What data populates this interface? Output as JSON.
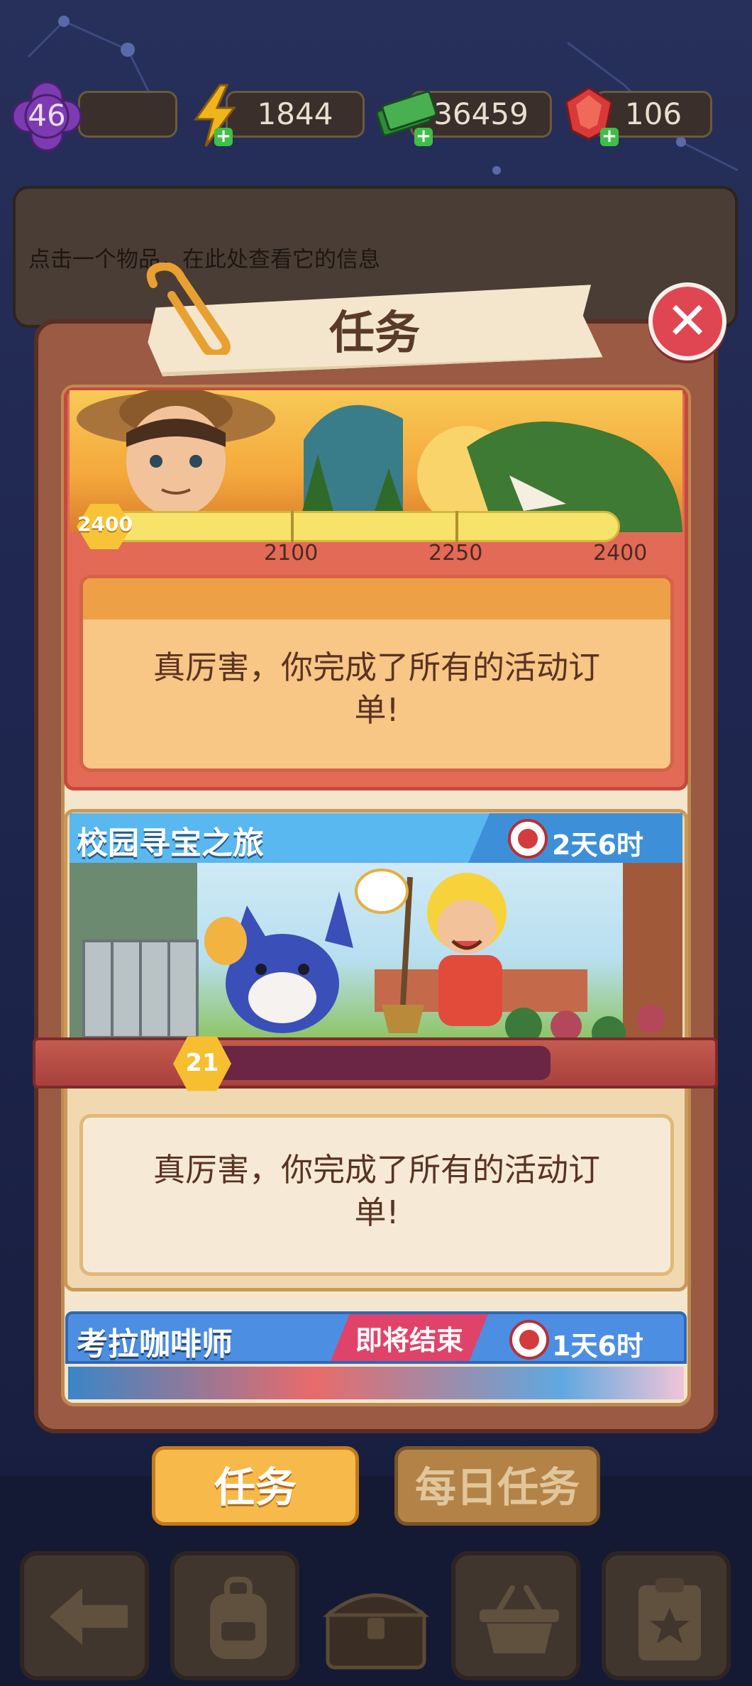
{
  "stats": {
    "level": "46",
    "energy": "1844",
    "cash": "36459",
    "gems": "106"
  },
  "info_panel": {
    "hint": "点击一个物品，在此处查看它的信息"
  },
  "dialog": {
    "title": "任务",
    "close_label": "✕"
  },
  "event_cards": [
    {
      "points": "2400",
      "milestones": [
        "2100",
        "2250",
        "2400"
      ],
      "message_line1": "真厉害，你完成了所有的活动订",
      "message_line2": "单!"
    },
    {
      "title": "校园寻宝之旅",
      "timer": "2天6时",
      "level": "21",
      "message_line1": "真厉害，你完成了所有的活动订",
      "message_line2": "单!"
    },
    {
      "title": "考拉咖啡师",
      "badge": "即将结束",
      "timer": "1天6时"
    }
  ],
  "tabs": {
    "quests": "任务",
    "daily": "每日任务"
  },
  "bottom_nav": [
    "back-icon",
    "backpack-icon",
    "treasure-chest-icon",
    "shop-basket-icon",
    "quest-board-icon"
  ],
  "colors": {
    "background": "#1f2750",
    "dialog": "#9b5a44",
    "accent_orange": "#f7b94a",
    "header_blue": "#59b8ef",
    "ending_pink": "#e0436a"
  }
}
